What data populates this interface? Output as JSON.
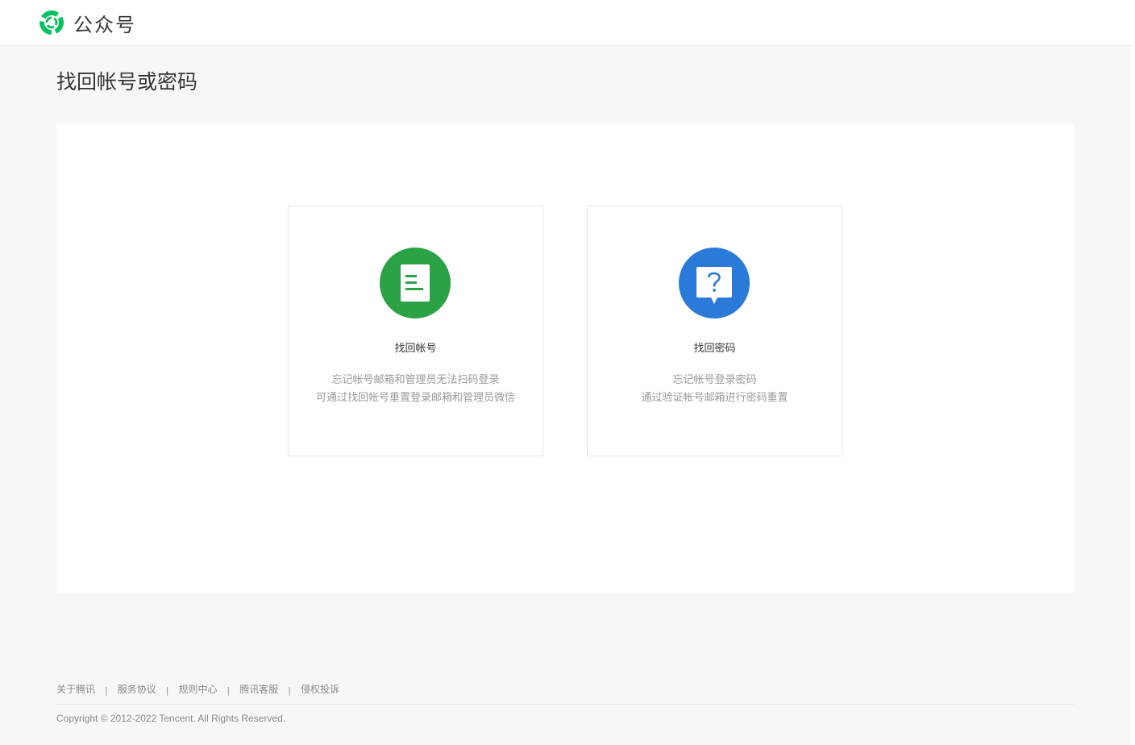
{
  "header": {
    "logo_icon": "wechat-official-accounts-logo-icon",
    "logo_text": "公众号"
  },
  "page": {
    "title": "找回帐号或密码"
  },
  "cards": [
    {
      "icon": "document-icon",
      "icon_color": "#2ba245",
      "title": "找回帐号",
      "desc_line1": "忘记帐号邮箱和管理员无法扫码登录",
      "desc_line2": "可通过找回帐号重置登录邮箱和管理员微信"
    },
    {
      "icon": "question-bubble-icon",
      "icon_color": "#2a7ad9",
      "title": "找回密码",
      "desc_line1": "忘记帐号登录密码",
      "desc_line2": "通过验证帐号邮箱进行密码重置"
    }
  ],
  "footer": {
    "links": [
      "关于腾讯",
      "服务协议",
      "规则中心",
      "腾讯客服",
      "侵权投诉"
    ],
    "separator": "|",
    "copyright": "Copyright © 2012-2022 Tencent. All Rights Reserved."
  }
}
